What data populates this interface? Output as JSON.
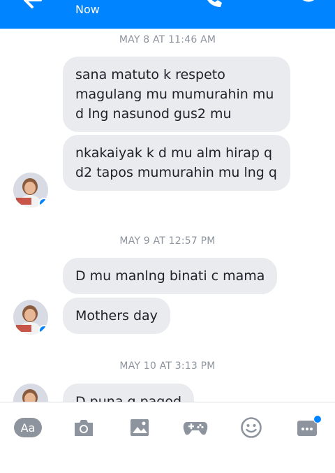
{
  "header": {
    "status": "Now",
    "background": "#0084ff",
    "icons": [
      "back-arrow-icon",
      "phone-icon",
      "video-icon",
      "info-icon"
    ]
  },
  "thread": {
    "groups": [
      {
        "timestamp": "MAY 8 AT 11:46 AM",
        "messages": [
          "sana matuto k respeto magulang mu mumurahin mu d lng nasunod gus2 mu",
          "nkakaiyak k d mu alm hirap q d2 tapos mumurahin mu lng q"
        ]
      },
      {
        "timestamp": "MAY 9 AT 12:57 PM",
        "messages": [
          "D mu manlng binati c mama",
          "Mothers day"
        ]
      },
      {
        "timestamp": "MAY 10 AT 3:13 PM",
        "messages": [
          "D puna q pagod"
        ]
      }
    ]
  },
  "toolbar": {
    "aa_label": "Aa",
    "icons": [
      "camera-icon",
      "gallery-icon",
      "games-icon",
      "emoji-icon",
      "more-icon"
    ],
    "accent": "#0084ff",
    "icon_color": "#8d949e"
  },
  "colors": {
    "bubble": "#e9ebee",
    "bubble_text": "#1d2129",
    "timestamp": "#8d949e"
  }
}
